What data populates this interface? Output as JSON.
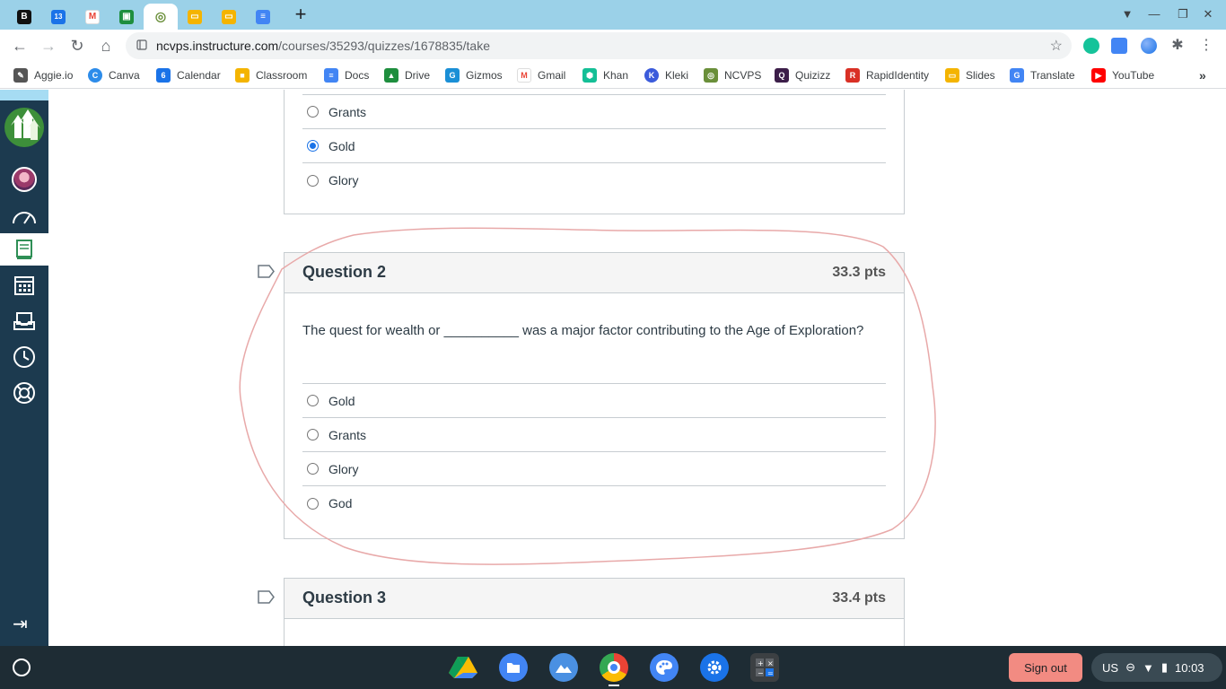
{
  "browser": {
    "tabs": [
      {
        "icon": "b-logo-icon",
        "color": "#111111",
        "glyph": "B"
      },
      {
        "icon": "calendar-icon",
        "color": "#1a73e8",
        "glyph": "13"
      },
      {
        "icon": "gmail-icon",
        "color": "#ffffff",
        "glyph": "M"
      },
      {
        "icon": "classroom-icon",
        "color": "#1e8e3e",
        "glyph": "▣"
      },
      {
        "icon": "ncvps-icon",
        "color": "#5f6368",
        "glyph": "◎",
        "active": true
      },
      {
        "icon": "slides-icon",
        "color": "#f4b400",
        "glyph": "▭"
      },
      {
        "icon": "slides-icon",
        "color": "#f4b400",
        "glyph": "▭"
      },
      {
        "icon": "docs-icon",
        "color": "#4285f4",
        "glyph": "≡"
      }
    ],
    "url_host": "ncvps.instructure.com",
    "url_path": "/courses/35293/quizzes/1678835/take"
  },
  "bookmarks": [
    {
      "label": "Aggie.io",
      "color": "#555555",
      "glyph": "✎"
    },
    {
      "label": "Canva",
      "color": "#2d8cea",
      "glyph": "C"
    },
    {
      "label": "Calendar",
      "color": "#1a73e8",
      "glyph": "6"
    },
    {
      "label": "Classroom",
      "color": "#f4b400",
      "glyph": "■"
    },
    {
      "label": "Docs",
      "color": "#4285f4",
      "glyph": "≡"
    },
    {
      "label": "Drive",
      "color": "#1e8e3e",
      "glyph": "▲"
    },
    {
      "label": "Gizmos",
      "color": "#1a8fd6",
      "glyph": "G"
    },
    {
      "label": "Gmail",
      "color": "#ea4335",
      "glyph": "M"
    },
    {
      "label": "Khan",
      "color": "#14bf96",
      "glyph": "⬢"
    },
    {
      "label": "Kleki",
      "color": "#3b5bdb",
      "glyph": "K"
    },
    {
      "label": "NCVPS",
      "color": "#6a8f3a",
      "glyph": "◎"
    },
    {
      "label": "Quizizz",
      "color": "#3c1e49",
      "glyph": "Q"
    },
    {
      "label": "RapidIdentity",
      "color": "#d93025",
      "glyph": "R"
    },
    {
      "label": "Slides",
      "color": "#f4b400",
      "glyph": "▭"
    },
    {
      "label": "Translate",
      "color": "#4285f4",
      "glyph": "G"
    },
    {
      "label": "YouTube",
      "color": "#ff0000",
      "glyph": "▶"
    }
  ],
  "sidebar": {
    "items": [
      "dashboard-icon",
      "courses-icon",
      "calendar-icon",
      "inbox-icon",
      "history-icon",
      "help-icon"
    ],
    "active": "courses-icon"
  },
  "question1": {
    "answers": [
      {
        "label": "Grants",
        "checked": false
      },
      {
        "label": "Gold",
        "checked": true
      },
      {
        "label": "Glory",
        "checked": false
      }
    ]
  },
  "question2": {
    "title": "Question 2",
    "points": "33.3 pts",
    "text": "The quest for wealth  or __________ was a major factor contributing to the Age of Exploration?",
    "answers": [
      {
        "label": "Gold",
        "checked": false
      },
      {
        "label": "Grants",
        "checked": false
      },
      {
        "label": "Glory",
        "checked": false
      },
      {
        "label": "God",
        "checked": false
      }
    ]
  },
  "question3": {
    "title": "Question 3",
    "points": "33.4 pts"
  },
  "shelf": {
    "signout": "Sign out",
    "locale": "US",
    "time": "10:03"
  },
  "colors": {
    "accent": "#1a73e8",
    "sidebar": "#1c3a4f",
    "annotation": "#e8a9a9",
    "signout": "#f28b82"
  }
}
